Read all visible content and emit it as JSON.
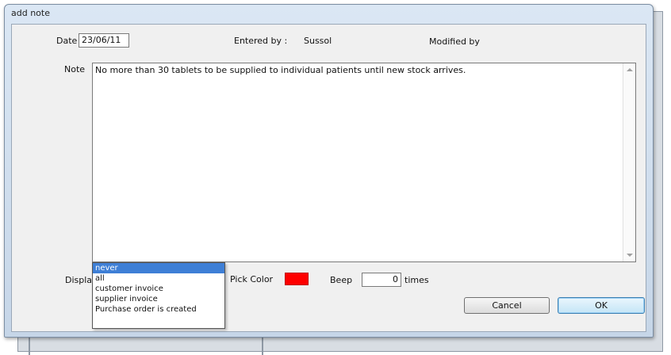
{
  "window": {
    "title": "add note"
  },
  "form": {
    "date_label": "Date",
    "date_value": "23/06/11",
    "entered_by_label": "Entered by :",
    "entered_by_value": "Sussol",
    "modified_by_label": "Modified by",
    "note_label": "Note",
    "note_text": "No more than 30 tablets to be supplied to individual patients until new stock arrives.",
    "display_label": "Display",
    "display_value": "never",
    "display_options": [
      "never",
      "all",
      "customer invoice",
      "supplier invoice",
      "Purchase order is created"
    ],
    "pick_color_label": "Pick Color",
    "pick_color_value": "#ff0000",
    "beep_label": "Beep",
    "beep_value": "0",
    "times_label": "times"
  },
  "buttons": {
    "cancel_label": "Cancel",
    "ok_label": "OK"
  }
}
